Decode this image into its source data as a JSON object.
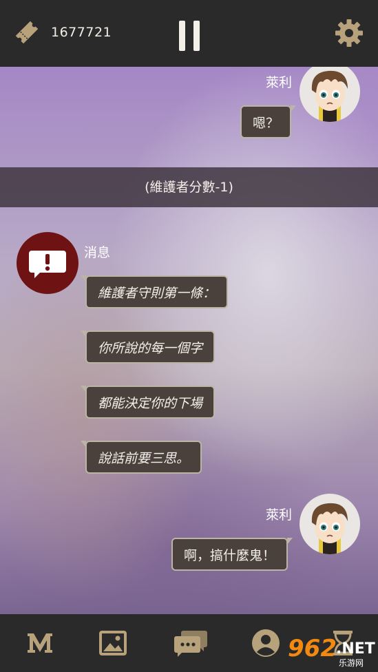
{
  "topbar": {
    "score": "1677721",
    "ticket_icon": "ticket-icon",
    "pause_icon": "pause-icon",
    "settings_icon": "gear-icon"
  },
  "chat": {
    "first": {
      "speaker": "萊利",
      "text": "嗯？"
    },
    "banner": "(維護者分數-1)",
    "system": {
      "speaker": "消息",
      "icon": "alert-message-icon",
      "lines": [
        "維護者守則第一條：",
        "你所說的每一個字",
        "都能決定你的下場",
        "說話前要三思。"
      ]
    },
    "last": {
      "speaker": "萊利",
      "text": "啊，搞什麼鬼！"
    }
  },
  "bottom_nav": {
    "items": [
      "m-logo-icon",
      "gallery-icon",
      "chat-icon",
      "profile-icon",
      "hourglass-icon"
    ]
  },
  "watermark": {
    "num": "962",
    "net": ".NET",
    "sub": "乐游网"
  },
  "colors": {
    "bar_bg": "#2b2a2a",
    "bubble_bg": "#4a403c",
    "bubble_border": "#bdb4a8",
    "icon_tan": "#b7a27c",
    "alert_red": "#6e1214"
  }
}
